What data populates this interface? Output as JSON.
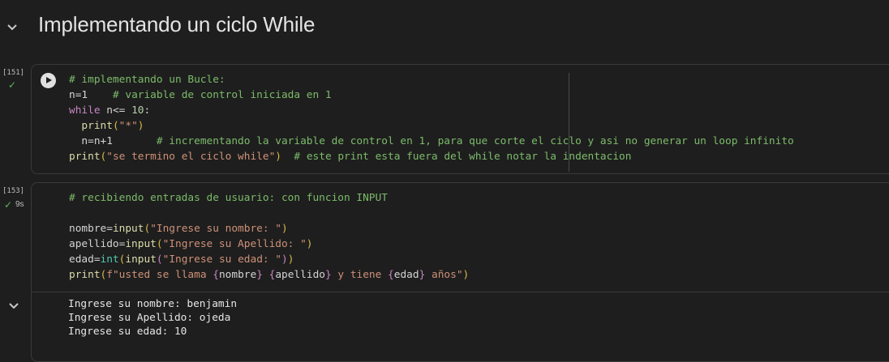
{
  "section": {
    "title": "Implementando un ciclo While"
  },
  "cell1": {
    "exec_count": "[151]",
    "lines": {
      "l1": "# implementando un Bucle:",
      "l2a": "n=1",
      "l2b": "# variable de control iniciada en 1",
      "l3a": "while",
      "l3b": " n<= ",
      "l3c": "10",
      "l3d": ":",
      "l4a": "print",
      "l4b": "(",
      "l4c": "\"*\"",
      "l4d": ")",
      "l5a": "n=n+1",
      "l5b": "# incrementando la variable de control en 1, para que corte el ciclo y asi no generar un loop infinito",
      "l6a": "print",
      "l6b": "(",
      "l6c": "\"se termino el ciclo while\"",
      "l6d": ")",
      "l6e": "# este print esta fuera del while notar la indentacion"
    }
  },
  "cell2": {
    "exec_count": "[153]",
    "exec_time": "9s",
    "lines": {
      "l1": "# recibiendo entradas de usuario: con funcion INPUT",
      "l2a": "nombre=",
      "l2b": "input",
      "l2c": "(",
      "l2d": "\"Ingrese su nombre: \"",
      "l2e": ")",
      "l3a": "apellido=",
      "l3b": "input",
      "l3c": "(",
      "l3d": "\"Ingrese su Apellido: \"",
      "l3e": ")",
      "l4a": "edad=",
      "l4b": "int",
      "l4c": "(",
      "l4d": "input",
      "l4e": "(",
      "l4f": "\"Ingrese su edad: \"",
      "l4g": ")",
      "l4h": ")",
      "l5a": "print",
      "l5b": "(",
      "l5c": "f\"usted se llama ",
      "l5d": "{",
      "l5e": "nombre",
      "l5f": "}",
      "l5g": " ",
      "l5h": "{",
      "l5i": "apellido",
      "l5j": "}",
      "l5k": " y tiene ",
      "l5l": "{",
      "l5m": "edad",
      "l5n": "}",
      "l5o": " años\"",
      "l5p": ")"
    },
    "output": [
      "Ingrese su nombre: benjamin",
      "Ingrese su Apellido: ojeda",
      "Ingrese su edad: 10"
    ]
  },
  "icons": {
    "section_toggle": "chevron-down-icon",
    "run": "play-circle-icon",
    "status": "check-icon",
    "output_toggle": "chevron-down-icon"
  },
  "colors": {
    "background": "#1e1e1e",
    "comment": "#7cbb6a",
    "keyword": "#c586c0",
    "function": "#dcdcaa",
    "string": "#ce9178",
    "number": "#b5cea8",
    "builtin": "#4ec9b0",
    "success": "#5fb55f"
  }
}
